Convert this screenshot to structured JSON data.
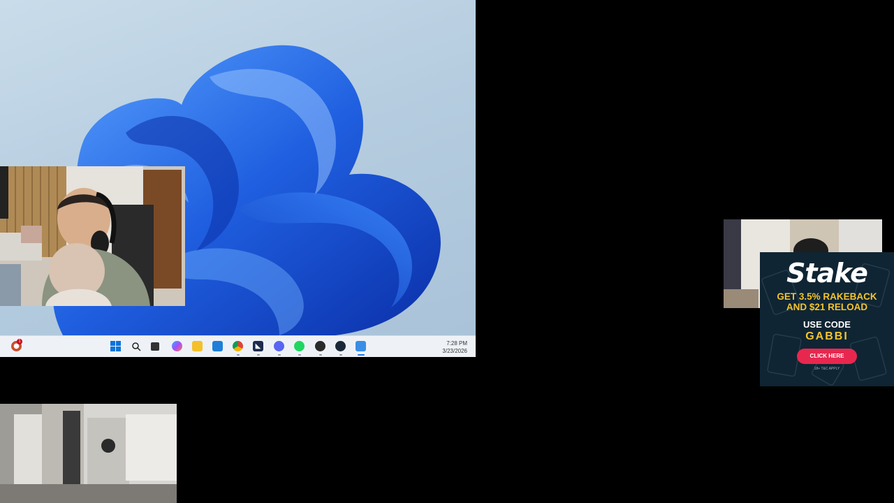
{
  "taskbar": {
    "clock_time": "7:28 PM",
    "clock_date": "3/23/2026",
    "notification_count": "1",
    "icons": [
      "windows-start-icon",
      "search-icon",
      "task-view-icon",
      "copilot-icon",
      "file-explorer-icon",
      "store-icon",
      "chrome-icon",
      "vscode-icon",
      "discord-icon",
      "spotify-icon",
      "obs-icon",
      "steam-icon",
      "photos-icon"
    ]
  },
  "ad": {
    "brand": "Stake",
    "promo_line1": "GET 3.5% RAKEBACK",
    "promo_line2": "AND $21 RELOAD",
    "use_code_label": "USE CODE",
    "code": "GABBI",
    "cta": "CLICK HERE",
    "terms": "18+ T&C APPLY"
  },
  "colors": {
    "ad_background": "#0f2533",
    "ad_accent": "#f4c430",
    "ad_button": "#e8274f",
    "wallpaper_blue": "#1f5fe0"
  }
}
